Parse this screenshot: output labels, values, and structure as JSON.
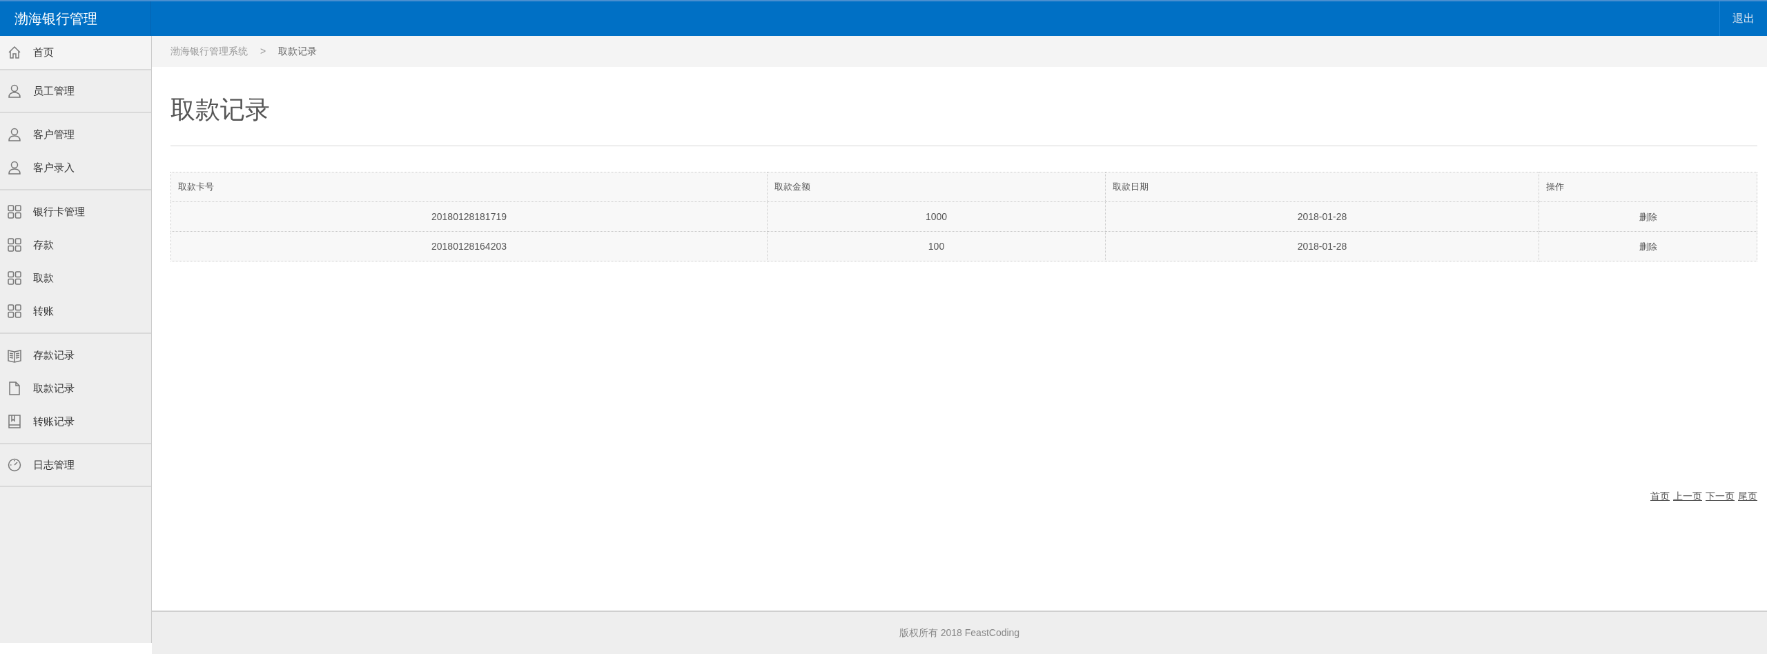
{
  "header": {
    "title": "渤海银行管理",
    "logout": "退出"
  },
  "sidebar": {
    "groups": [
      {
        "items": [
          {
            "label": "首页",
            "kind": "home"
          }
        ]
      },
      {
        "items": [
          {
            "label": "员工管理",
            "kind": "user"
          }
        ]
      },
      {
        "items": [
          {
            "label": "客户管理",
            "kind": "user"
          },
          {
            "label": "客户录入",
            "kind": "user"
          }
        ]
      },
      {
        "items": [
          {
            "label": "银行卡管理",
            "kind": "grid"
          },
          {
            "label": "存款",
            "kind": "grid"
          },
          {
            "label": "取款",
            "kind": "grid"
          },
          {
            "label": "转账",
            "kind": "grid"
          }
        ]
      },
      {
        "items": [
          {
            "label": "存款记录",
            "kind": "ledger"
          },
          {
            "label": "取款记录",
            "kind": "page"
          },
          {
            "label": "转账记录",
            "kind": "book"
          }
        ]
      },
      {
        "items": [
          {
            "label": "日志管理",
            "kind": "gauge"
          }
        ]
      }
    ]
  },
  "breadcrumb": [
    "渤海银行管理系统",
    ">",
    "取款记录"
  ],
  "page_title": "取款记录",
  "table": {
    "columns": [
      "取款卡号",
      "取款金额",
      "取款日期",
      "操作"
    ],
    "rows": [
      [
        "20180128181719",
        "1000",
        "2018-01-28",
        "删除"
      ],
      [
        "20180128164203",
        "100",
        "2018-01-28",
        "删除"
      ]
    ]
  },
  "pagination": [
    "首页",
    "上一页",
    "下一页",
    "尾页"
  ],
  "footer": "版权所有 2018 FeastCoding"
}
